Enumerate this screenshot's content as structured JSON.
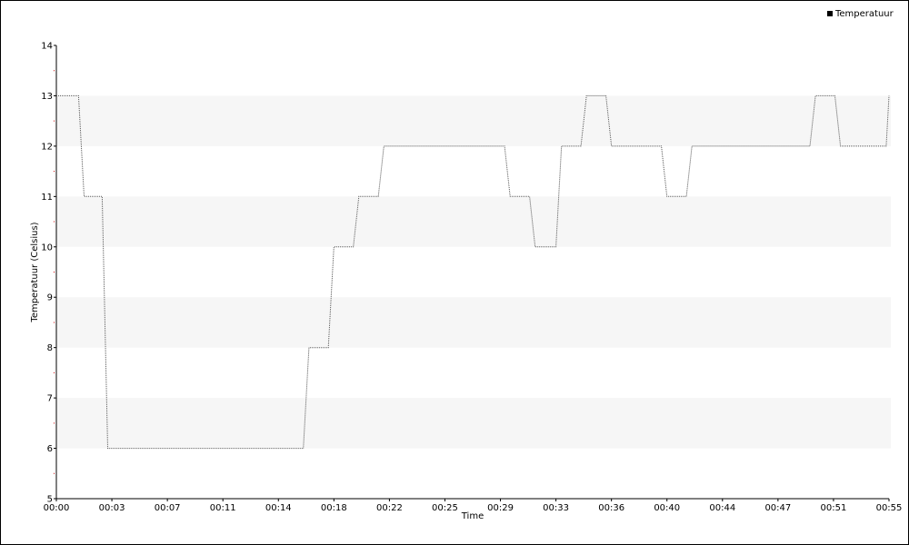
{
  "chart_data": {
    "type": "line",
    "xlabel": "Time",
    "ylabel": "Temperatuur (Celsius)",
    "ylim": [
      5,
      14
    ],
    "yticks": [
      5,
      6,
      7,
      8,
      9,
      10,
      11,
      12,
      13,
      14
    ],
    "xlim_minutes": [
      0,
      60
    ],
    "xtick_labels": [
      "00:00",
      "00:03",
      "00:07",
      "00:11",
      "00:14",
      "00:18",
      "00:22",
      "00:25",
      "00:29",
      "00:33",
      "00:36",
      "00:40",
      "00:44",
      "00:47",
      "00:51",
      "00:55"
    ],
    "xtick_minutes": [
      0,
      4,
      8,
      12,
      16,
      20,
      24,
      28,
      32,
      36,
      40,
      44,
      48,
      52,
      56,
      60
    ],
    "grid_bands": "alternating light gray horizontal bands",
    "legend_position": "top-right",
    "line_color": "#555555",
    "band_color": "#f6f6f6",
    "series": [
      {
        "name": "Temperatuur",
        "x_minutes": [
          0,
          1.6,
          2.0,
          3.3,
          3.7,
          17.8,
          18.2,
          19.6,
          20.0,
          21.4,
          21.8,
          23.2,
          23.6,
          32.3,
          32.7,
          34.1,
          34.5,
          36.0,
          36.4,
          37.8,
          38.2,
          39.6,
          40.0,
          43.6,
          44.0,
          45.4,
          45.8,
          54.3,
          54.7,
          56.1,
          56.5,
          59.8,
          60
        ],
        "y": [
          13,
          13,
          11,
          11,
          6,
          6,
          8,
          8,
          10,
          10,
          11,
          11,
          12,
          12,
          11,
          11,
          10,
          10,
          12,
          12,
          13,
          13,
          12,
          12,
          11,
          11,
          12,
          12,
          13,
          13,
          12,
          12,
          13
        ]
      }
    ]
  }
}
